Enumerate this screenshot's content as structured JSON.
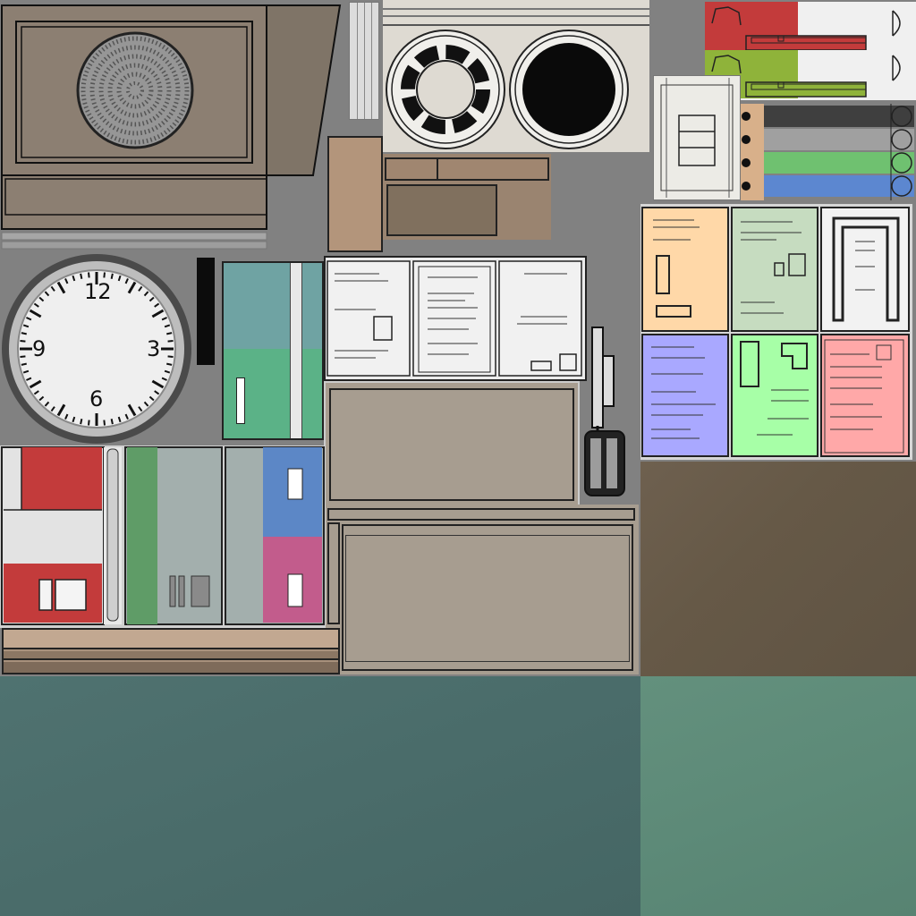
{
  "atlas": {
    "title": "",
    "colors": {
      "background": "#818181",
      "speaker_panel": "#8c7f72",
      "floor_brown": "#675a4a",
      "floor_teal_dark": "#4a6c6a",
      "floor_teal_light": "#5d8a78",
      "cream_panel": "#dedad2",
      "cardboard": "#a79d90",
      "wood": "#b3957b"
    }
  },
  "clock": {
    "numbers": {
      "twelve": "12",
      "three": "3",
      "six": "6",
      "nine": "9"
    }
  },
  "labels": {
    "tabs": [
      "red-tab",
      "green-tab"
    ],
    "color_strips": [
      "#3f3f3f",
      "#a0a0a0",
      "#6fc170",
      "#5c87d0"
    ]
  },
  "posters": {
    "grid_colors": [
      "#ffd8a8",
      "#c6dcc0",
      "#f2f2f2",
      "#a9a8ff",
      "#a7ffa7",
      "#ffa8a8"
    ]
  },
  "icons": [
    "speaker-grille-icon",
    "vent-icon",
    "porthole-icon",
    "clock-icon",
    "door-handle-icon",
    "light-switch-icon"
  ]
}
